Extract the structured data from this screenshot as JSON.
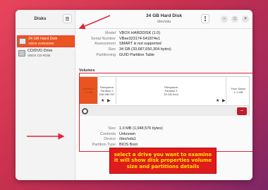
{
  "sidebar": {
    "title": "Disks",
    "drives": [
      {
        "name": "34 GB Hard Disk",
        "model": "VBOX HARDDISK",
        "selected": true
      },
      {
        "name": "CD/DVD Drive",
        "model": "VBOX CD-ROM",
        "selected": false
      }
    ]
  },
  "header": {
    "title": "34 GB Hard Disk",
    "subtitle": "/dev/sda",
    "minimize": "−",
    "maximize": "□",
    "close": "×"
  },
  "disk_props": [
    {
      "key": "Model",
      "value": "VBOX HARDDISK (1.0)"
    },
    {
      "key": "Serial Number",
      "value": "VBee323174-541874e1"
    },
    {
      "key": "Assessment",
      "value": "SMART is not supported"
    },
    {
      "key": "Size",
      "value": "34 GB (33,687,650,304 bytes)"
    },
    {
      "key": "Partitioning",
      "value": "GUID Partition Table"
    }
  ],
  "volumes": {
    "title": "Volumes",
    "partitions": [
      {
        "label1": "Partition 1",
        "label2": "1.0 MB",
        "selected": true
      },
      {
        "label1": "Filesystem",
        "label2": "Partition 2",
        "label3": "538 MB FAT"
      },
      {
        "label1": "Filesystem",
        "label2": "Partition 3",
        "label3": "33 GB Ext4"
      },
      {
        "label1": "Free Space",
        "label2": "1.1 MB"
      }
    ],
    "stars": "★ ▶"
  },
  "partition_props": [
    {
      "key": "Size",
      "value": "1.0 MB (1,048,576 bytes)"
    },
    {
      "key": "Contents",
      "value": "Unknown"
    },
    {
      "key": "Device",
      "value": "/dev/sda1"
    },
    {
      "key": "Partition Type",
      "value": "BIOS Boot"
    }
  ],
  "annotation": {
    "line1": "select a drive you want to examine",
    "line2": "it will show disk properties volume",
    "line3": "size and partitions details"
  },
  "colors": {
    "accent": "#e95420",
    "annotation_bg": "#e01b1b",
    "annotation_text": "#ffe600",
    "highlight": "#e0243a"
  }
}
